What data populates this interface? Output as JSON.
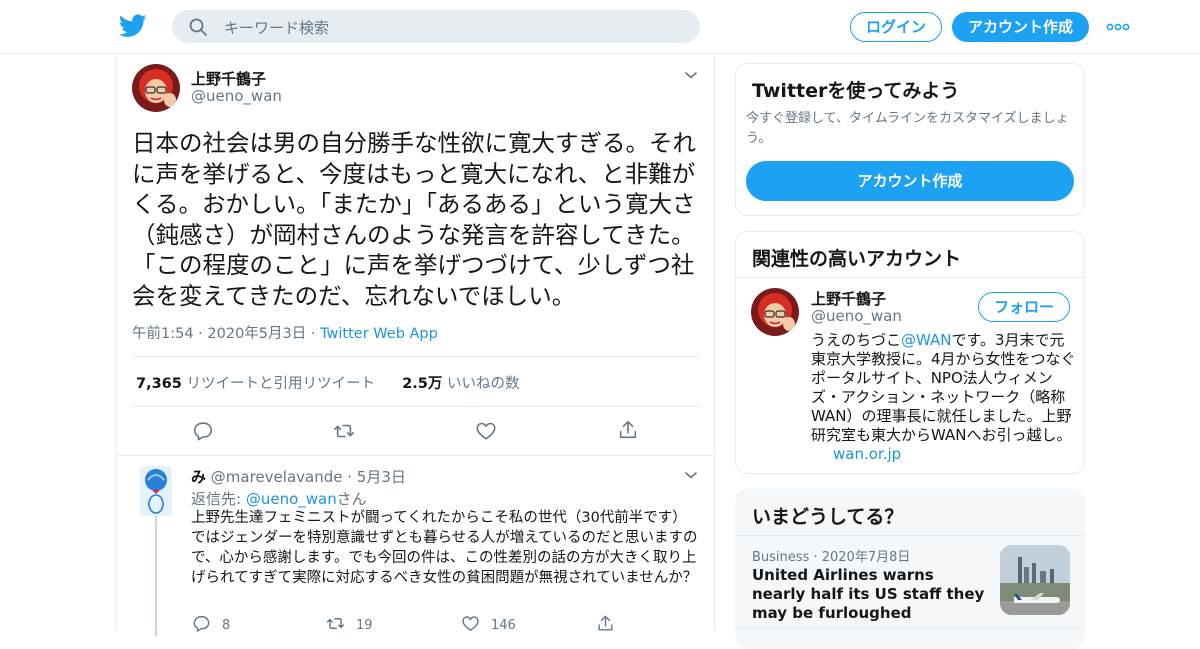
{
  "header": {
    "search_placeholder": "キーワード検索",
    "login_label": "ログイン",
    "signup_label": "アカウント作成",
    "brand_color": "#1da1f2"
  },
  "tweet": {
    "author_name": "上野千鶴子",
    "author_handle": "@ueno_wan",
    "text": "日本の社会は男の自分勝手な性欲に寛大すぎる。それに声を挙げると、今度はもっと寛大になれ、と非難がくる。おかしい。「またか」「あるある」という寛大さ（鈍感さ）が岡村さんのような発言を許容してきた。「この程度のこと」に声を挙げつづけて、少しずつ社会を変えてきたのだ、忘れないでほしい。",
    "time": "午前1:54",
    "date": "2020年5月3日",
    "source": "Twitter Web App",
    "retweet_count": "7,365",
    "retweet_label": "リツイートと引用リツイート",
    "like_count": "2.5万",
    "like_label": "いいねの数"
  },
  "reply": {
    "author_name": "み",
    "author_handle": "@marevelavande",
    "date": "5月3日",
    "reply_to_prefix": "返信先: ",
    "reply_to_handle": "@ueno_wan",
    "reply_to_suffix": "さん",
    "text": "上野先生達フェミニストが闘ってくれたからこそ私の世代（30代前半です）ではジェンダーを特別意識せずとも暮らせる人が増えているのだと思いますので、心から感謝します。でも今回の件は、この性差別の話の方が大きく取り上げられてすぎて実際に対応するべき女性の貧困問題が無視されていませんか？",
    "reply_count": "8",
    "retweet_count": "19",
    "like_count": "146"
  },
  "sidebar": {
    "signup_card": {
      "title": "Twitterを使ってみよう",
      "description": "今すぐ登録して、タイムラインをカスタマイズしましょう。",
      "button_label": "アカウント作成"
    },
    "related_card": {
      "title": "関連性の高いアカウント",
      "name": "上野千鶴子",
      "handle": "@ueno_wan",
      "follow_label": "フォロー",
      "bio_prefix": "うえのちづこ",
      "bio_link": "@WAN",
      "bio_rest": "です。3月末で元東京大学教授に。4月から女性をつなぐポータルサイト、NPO法人ウィメンズ・アクション・ネットワーク（略称WAN）の理事長に就任しました。上野研究室も東大からWANへお引っ越し。",
      "bio_url": "wan.or.jp"
    },
    "trends_card": {
      "title": "いまどうしてる？",
      "category": "Business",
      "date": "2020年7月8日",
      "headline": "United Airlines warns nearly half its US staff they may be furloughed"
    }
  }
}
